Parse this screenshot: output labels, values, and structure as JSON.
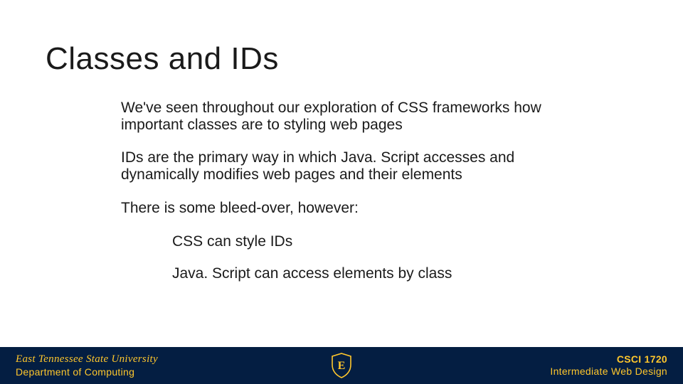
{
  "title": "Classes and IDs",
  "paragraphs": [
    "We've seen throughout our exploration of CSS frameworks how important classes are to styling web pages",
    "IDs are the primary way in which Java. Script accesses and dynamically modifies web pages and their elements",
    "There is some bleed-over, however:"
  ],
  "sub_items": [
    "CSS can style IDs",
    "Java. Script can access elements by class"
  ],
  "footer": {
    "left_line1": "East Tennessee State University",
    "left_line2": "Department of Computing",
    "right_line1": "CSCI 1720",
    "right_line2": "Intermediate Web Design",
    "logo_letter": "E"
  }
}
